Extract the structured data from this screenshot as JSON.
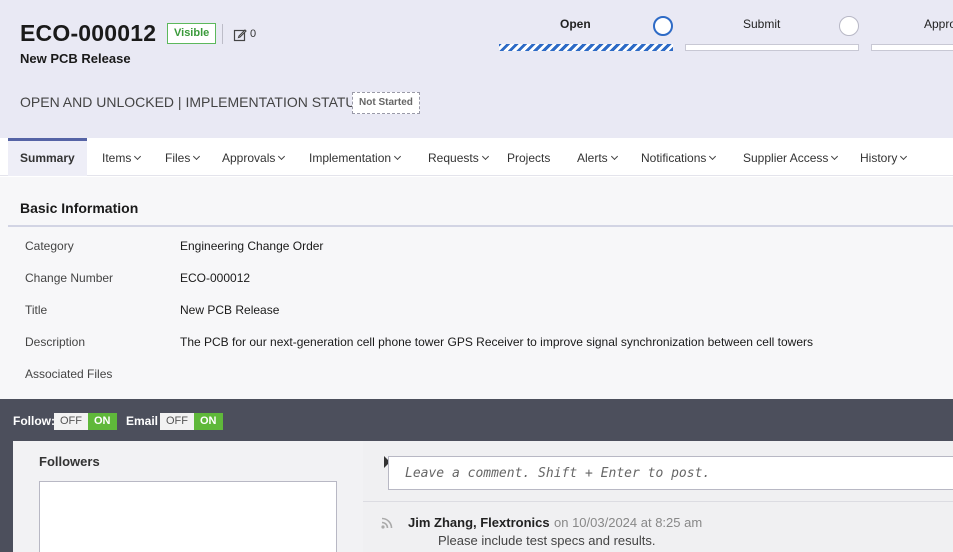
{
  "record": {
    "id": "ECO-000012",
    "title": "New PCB Release",
    "visibility_badge": "Visible",
    "edit_count": "0",
    "status_text": "OPEN AND UNLOCKED | IMPLEMENTATION STATUS:",
    "implementation_status": "Not Started"
  },
  "workflow": {
    "steps": [
      {
        "label": "Open",
        "state": "active"
      },
      {
        "label": "Submit",
        "state": "pending"
      },
      {
        "label": "Appro",
        "state": "pending"
      }
    ]
  },
  "tabs": [
    {
      "label": "Summary",
      "active": true,
      "dropdown": false
    },
    {
      "label": "Items",
      "dropdown": true
    },
    {
      "label": "Files",
      "dropdown": true
    },
    {
      "label": "Approvals",
      "dropdown": true
    },
    {
      "label": "Implementation",
      "dropdown": true
    },
    {
      "label": "Requests",
      "dropdown": true
    },
    {
      "label": "Projects",
      "dropdown": false
    },
    {
      "label": "Alerts",
      "dropdown": true
    },
    {
      "label": "Notifications",
      "dropdown": true
    },
    {
      "label": "Supplier Access",
      "dropdown": true
    },
    {
      "label": "History",
      "dropdown": true
    }
  ],
  "basic_info": {
    "section_title": "Basic Information",
    "fields": [
      {
        "label": "Category",
        "value": "Engineering Change Order"
      },
      {
        "label": "Change Number",
        "value": "ECO-000012"
      },
      {
        "label": "Title",
        "value": "New PCB Release"
      },
      {
        "label": "Description",
        "value": "The PCB for our next-generation cell phone tower GPS Receiver to improve signal synchronization  between cell towers"
      },
      {
        "label": "Associated Files",
        "value": ""
      }
    ]
  },
  "social": {
    "follow_label": "Follow:",
    "email_label": "Email",
    "toggle_off": "OFF",
    "toggle_on": "ON",
    "followers_title": "Followers",
    "comment_placeholder": "Leave a comment. Shift + Enter to post.",
    "comment": {
      "author": "Jim Zhang, Flextronics",
      "meta": "on 10/03/2024 at 8:25 am",
      "body": "Please include test specs and results."
    }
  },
  "colors": {
    "header_bg": "#e9e9f4",
    "accent": "#2e6bc6",
    "tab_accent": "#5563a5",
    "toggle_on": "#5fb83a",
    "bottom_bg": "#4c4f5c"
  }
}
